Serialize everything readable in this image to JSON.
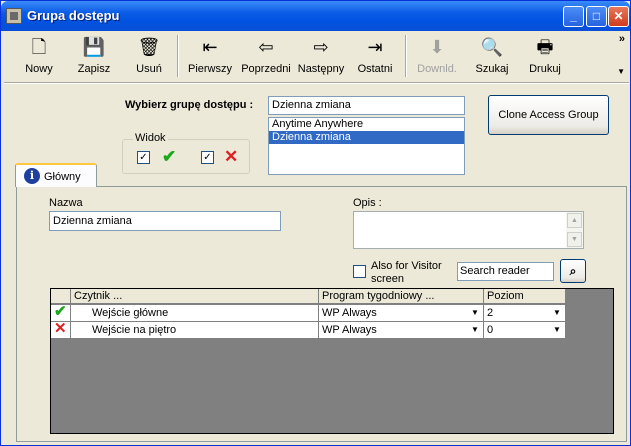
{
  "window": {
    "title": "Grupa dostępu",
    "min": "_",
    "max": "□",
    "close": "✕"
  },
  "toolbar": {
    "items": [
      {
        "label": "Nowy",
        "icon": "new-document-icon",
        "glyph": "🗋",
        "enabled": true
      },
      {
        "label": "Zapisz",
        "icon": "save-disk-icon",
        "glyph": "💾",
        "enabled": true
      },
      {
        "label": "Usuń",
        "icon": "trash-can-icon",
        "glyph": "🗑",
        "enabled": true
      },
      {
        "label": "Pierwszy",
        "icon": "first-record-icon",
        "glyph": "⇤",
        "enabled": true
      },
      {
        "label": "Poprzedni",
        "icon": "previous-record-icon",
        "glyph": "⇦",
        "enabled": true
      },
      {
        "label": "Następny",
        "icon": "next-record-icon",
        "glyph": "⇨",
        "enabled": true
      },
      {
        "label": "Ostatni",
        "icon": "last-record-icon",
        "glyph": "⇥",
        "enabled": true
      },
      {
        "label": "Downld.",
        "icon": "download-device-icon",
        "glyph": "⬇",
        "enabled": false
      },
      {
        "label": "Szukaj",
        "icon": "search-globe-icon",
        "glyph": "🔍",
        "enabled": true
      },
      {
        "label": "Drukuj",
        "icon": "printer-icon",
        "glyph": "🖶",
        "enabled": true
      }
    ],
    "more": "»"
  },
  "group_select": {
    "label": "Wybierz grupę dostępu :",
    "value": "Dzienna zmiana",
    "options": [
      {
        "label": "Anytime Anywhere",
        "selected": false
      },
      {
        "label": "Dzienna zmiana",
        "selected": true
      }
    ]
  },
  "clone_button": "Clone Access Group",
  "view": {
    "legend": "Widok",
    "checkbox_mark": "✓",
    "check_glyph": "✔",
    "cross_glyph": "✕"
  },
  "tabs": [
    {
      "label": "Główny",
      "active": true
    }
  ],
  "form": {
    "name_label": "Nazwa",
    "name_value": "Dzienna zmiana",
    "desc_label": "Opis :",
    "desc_value": "",
    "visitor_label_1": "Also for Visitor",
    "visitor_label_2": "screen",
    "visitor_checked": false,
    "search_value": "Search reader",
    "search_glyph": "⌕"
  },
  "grid": {
    "columns": [
      "",
      "Czytnik ...",
      "Program tygodniowy ...",
      "Poziom"
    ],
    "rows": [
      {
        "status": "allowed",
        "reader": "Wejście główne",
        "program": "WP Always",
        "level": "2"
      },
      {
        "status": "denied",
        "reader": "Wejście na piętro",
        "program": "WP Always",
        "level": "0"
      }
    ],
    "dropdown_glyph": "▼"
  }
}
